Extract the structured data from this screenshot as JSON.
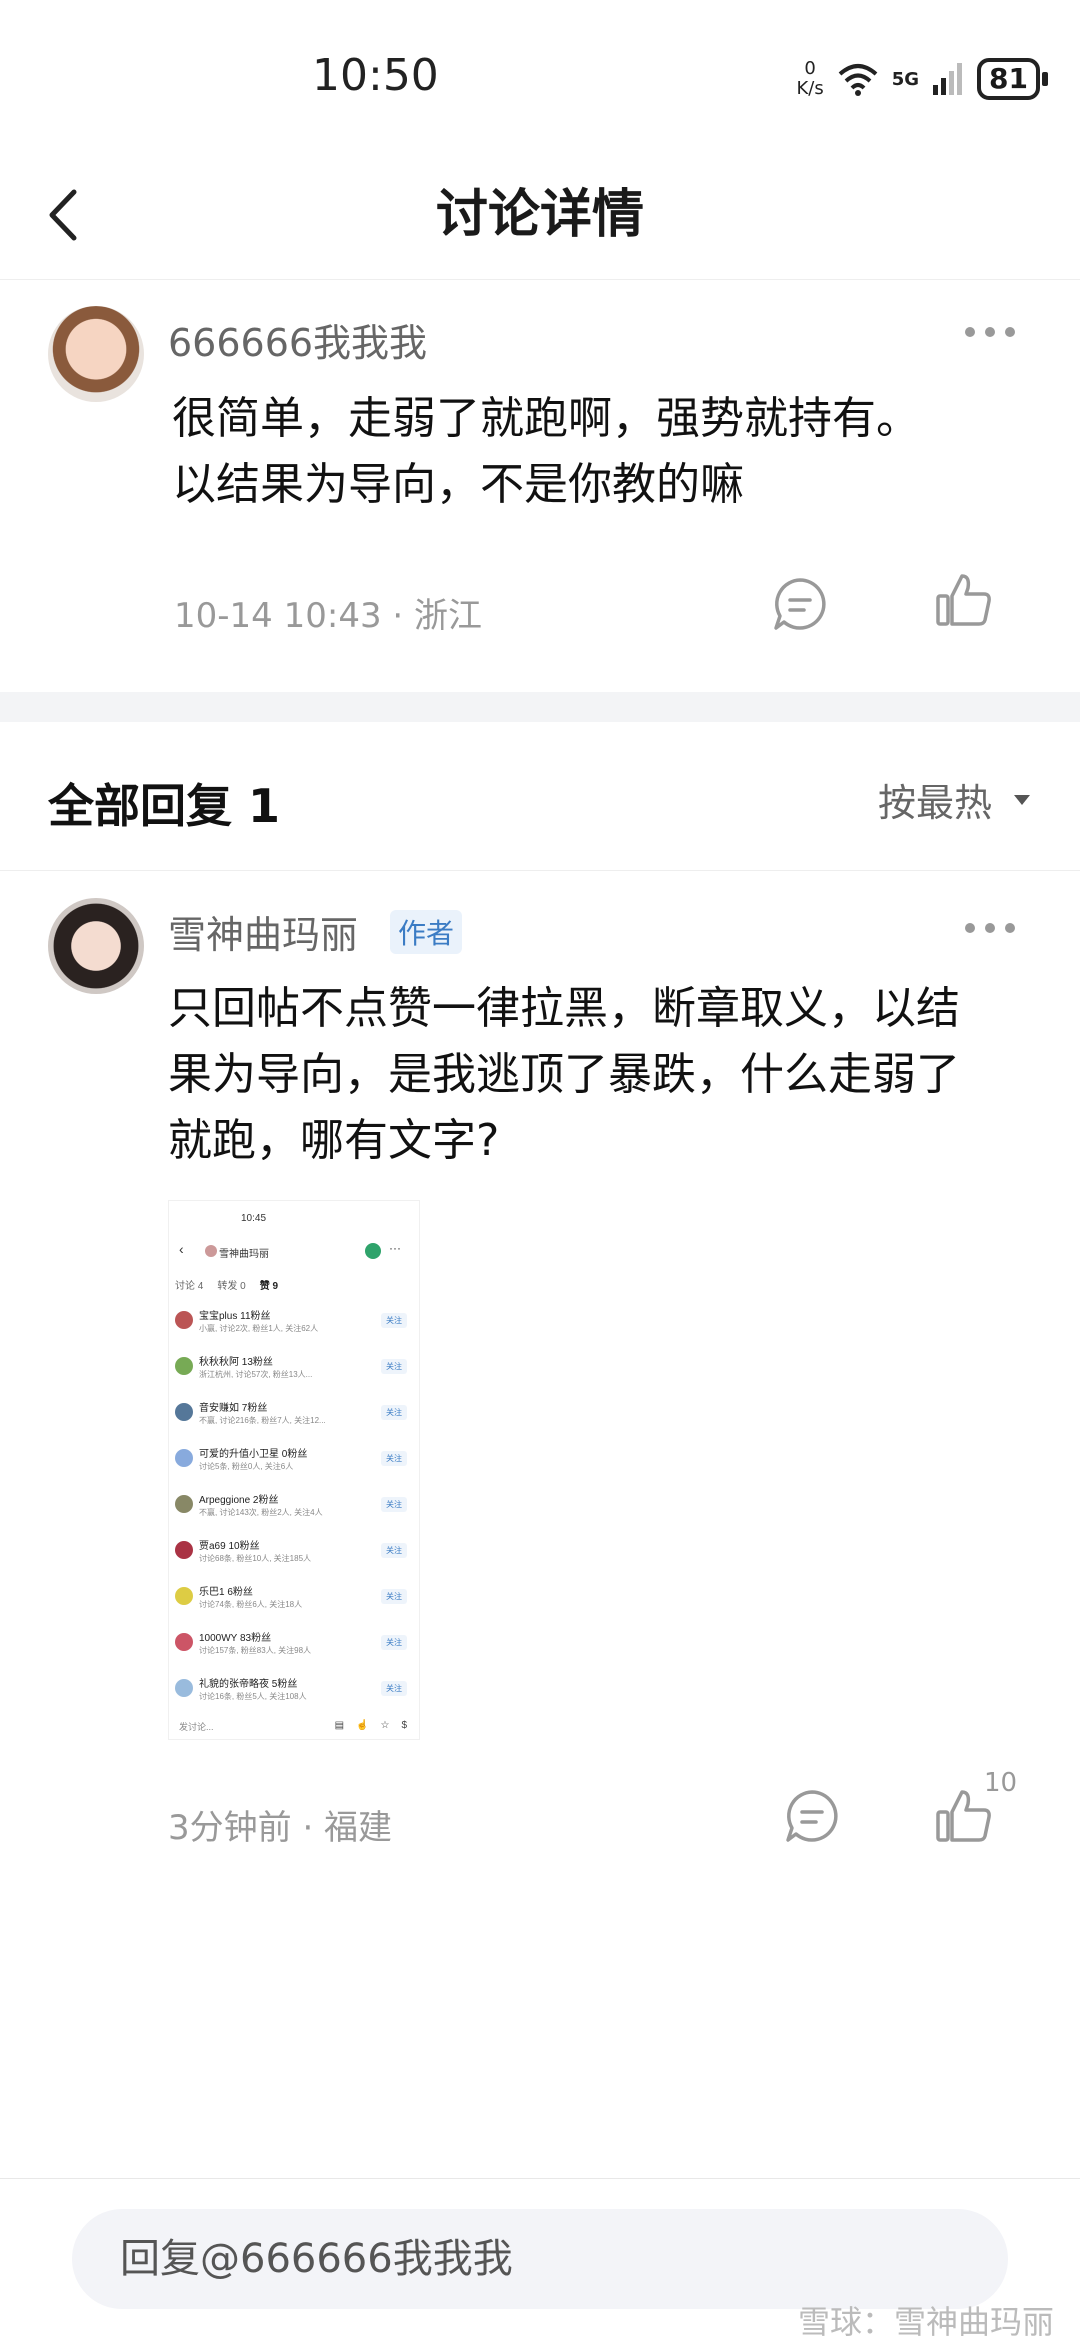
{
  "status_bar": {
    "time": "10:50",
    "speed_value": "0",
    "speed_unit": "K/s",
    "network": "5G",
    "battery": "81"
  },
  "header": {
    "title": "讨论详情"
  },
  "post": {
    "username": "666666我我我",
    "content_line1": "很简单，走弱了就跑啊，强势就持有。",
    "content_line2": "以结果为导向，不是你教的嘛",
    "meta": "10-14 10:43 · 浙江"
  },
  "replies": {
    "title": "全部回复 1",
    "sort_label": "按最热"
  },
  "reply": {
    "username": "雪神曲玛丽",
    "badge": "作者",
    "content_line1": "只回帖不点赞一律拉黑，断章取义，以结",
    "content_line2": "果为导向，是我逃顶了暴跌，什么走弱了",
    "content_line3": "就跑，哪有文字?",
    "meta": "3分钟前 · 福建",
    "like_count": "10"
  },
  "thumbnail": {
    "time": "10:45",
    "name": "雪神曲玛丽",
    "tabs": [
      "讨论 4",
      "转发 0",
      "赞 9"
    ],
    "rows": [
      {
        "name": "宝宝plus 11粉丝",
        "sub": "小赢, 讨论2次, 粉丝1人, 关注62人",
        "btn": "关注",
        "color": "#b55"
      },
      {
        "name": "秋秋秋阿 13粉丝",
        "sub": "浙江杭州, 讨论57次, 粉丝13人...",
        "btn": "关注",
        "color": "#7a5"
      },
      {
        "name": "音安赚如 7粉丝",
        "sub": "不赢, 讨论216条, 粉丝7人, 关注12...",
        "btn": "关注",
        "color": "#579"
      },
      {
        "name": "可爱的升值小卫星 0粉丝",
        "sub": "讨论5条, 粉丝0人, 关注6人",
        "btn": "关注",
        "color": "#8ad"
      },
      {
        "name": "Arpeggione 2粉丝",
        "sub": "不赢, 讨论143次, 粉丝2人, 关注4人",
        "btn": "关注",
        "color": "#886"
      },
      {
        "name": "贾a69 10粉丝",
        "sub": "讨论68条, 粉丝10人, 关注185人",
        "btn": "关注",
        "color": "#a34"
      },
      {
        "name": "乐巴1 6粉丝",
        "sub": "讨论74条, 粉丝6人, 关注18人",
        "btn": "关注",
        "color": "#dc4"
      },
      {
        "name": "1000WY 83粉丝",
        "sub": "讨论157条, 粉丝83人, 关注98人",
        "btn": "关注",
        "color": "#c56"
      },
      {
        "name": "礼貌的张帝略夜 5粉丝",
        "sub": "讨论16条, 粉丝5人, 关注108人",
        "btn": "关注",
        "color": "#9bd"
      }
    ],
    "input_placeholder": "发讨论..."
  },
  "bottom": {
    "reply_placeholder": "回复@666666我我我",
    "watermark": "雪球：雪神曲玛丽"
  },
  "colors": {
    "accent_blue": "#3b7cc4",
    "muted": "#999999",
    "divider": "#f3f4f6"
  }
}
